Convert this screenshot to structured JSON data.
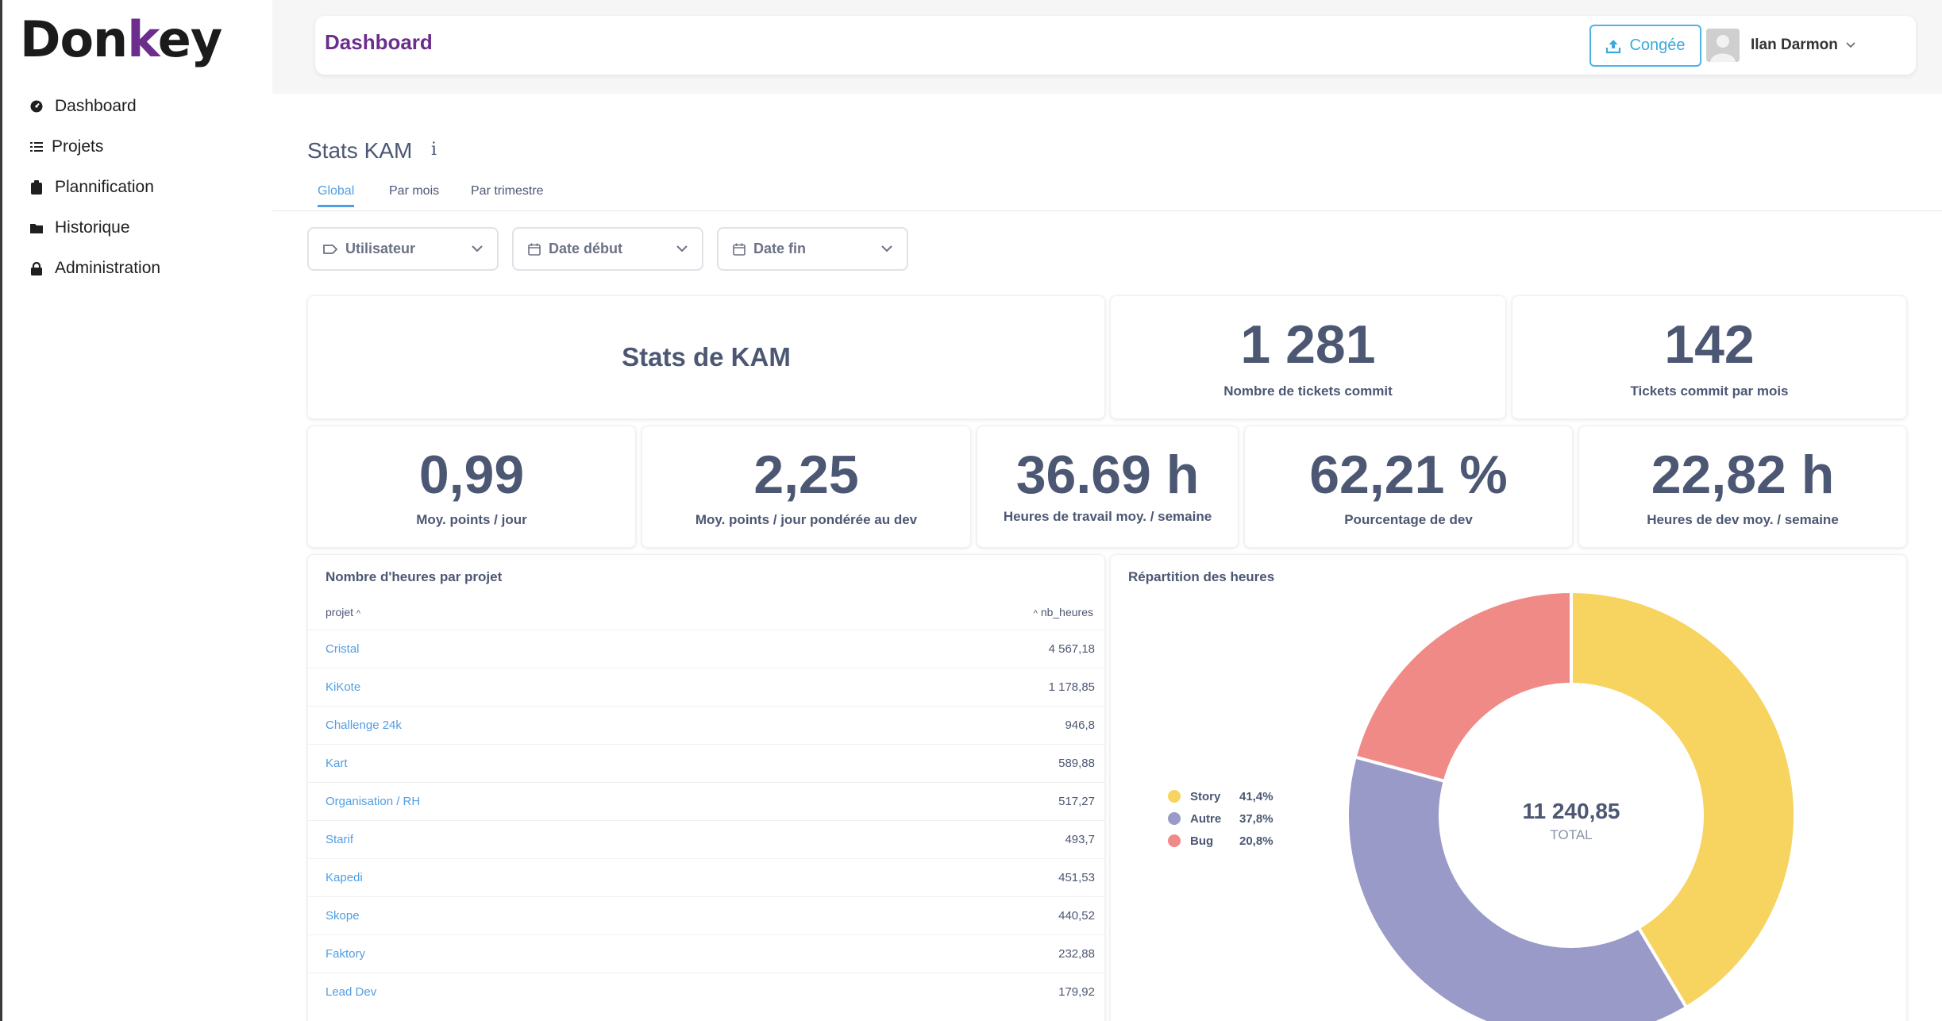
{
  "app": {
    "logo_text_1": "Don",
    "logo_text_2": "k",
    "logo_text_3": "ey"
  },
  "sidebar": {
    "items": [
      {
        "label": "Dashboard",
        "icon": "dashboard-icon"
      },
      {
        "label": "Projets",
        "icon": "list-icon"
      },
      {
        "label": "Plannification",
        "icon": "clipboard-icon"
      },
      {
        "label": "Historique",
        "icon": "folder-icon"
      },
      {
        "label": "Administration",
        "icon": "lock-icon"
      }
    ]
  },
  "header": {
    "title": "Dashboard",
    "conge_label": "Congée",
    "user_name": "Ilan Darmon"
  },
  "page": {
    "title": "Stats KAM",
    "tabs": [
      "Global",
      "Par mois",
      "Par trimestre"
    ],
    "active_tab": "Global"
  },
  "filters": [
    {
      "label": "Utilisateur",
      "icon": "tag-icon"
    },
    {
      "label": "Date début",
      "icon": "calendar-icon"
    },
    {
      "label": "Date fin",
      "icon": "calendar-icon"
    }
  ],
  "stats": {
    "title_card": "Stats de KAM",
    "tickets_commit": {
      "value": "1 281",
      "caption": "Nombre de tickets commit"
    },
    "tickets_per_month": {
      "value": "142",
      "caption": "Tickets commit par mois"
    },
    "points_per_day": {
      "value": "0,99",
      "caption": "Moy. points / jour"
    },
    "points_weighted": {
      "value": "2,25",
      "caption": "Moy. points / jour pondérée au dev"
    },
    "work_hours": {
      "value": "36.69 h",
      "caption": "Heures de travail moy. / semaine"
    },
    "dev_pct": {
      "value": "62,21 %",
      "caption": "Pourcentage de dev"
    },
    "dev_hours": {
      "value": "22,82 h",
      "caption": "Heures de dev moy. / semaine"
    }
  },
  "hours_table": {
    "title": "Nombre d'heures par projet",
    "col_project": "projet",
    "col_hours": "nb_heures",
    "rows": [
      {
        "projet": "Cristal",
        "nb_heures": "4 567,18"
      },
      {
        "projet": "KiKote",
        "nb_heures": "1 178,85"
      },
      {
        "projet": "Challenge 24k",
        "nb_heures": "946,8"
      },
      {
        "projet": "Kart",
        "nb_heures": "589,88"
      },
      {
        "projet": "Organisation / RH",
        "nb_heures": "517,27"
      },
      {
        "projet": "Starif",
        "nb_heures": "493,7"
      },
      {
        "projet": "Kapedi",
        "nb_heures": "451,53"
      },
      {
        "projet": "Skope",
        "nb_heures": "440,52"
      },
      {
        "projet": "Faktory",
        "nb_heures": "232,88"
      },
      {
        "projet": "Lead Dev",
        "nb_heures": "179,92"
      }
    ]
  },
  "chart_data": {
    "type": "pie",
    "title": "Répartition des heures",
    "center_value": "11 240,85",
    "center_label": "TOTAL",
    "categories": [
      "Story",
      "Autre",
      "Bug"
    ],
    "values": [
      41.4,
      37.8,
      20.8
    ],
    "labels": [
      "41,4%",
      "37,8%",
      "20,8%"
    ],
    "colors": [
      "#f7d35f",
      "#9a9ac8",
      "#ef8a87"
    ]
  },
  "colors": {
    "brand": "#6b2e8c",
    "accent": "#509ee3",
    "text": "#4c5773"
  }
}
